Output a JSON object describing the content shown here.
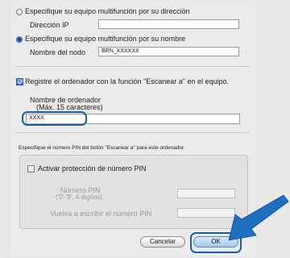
{
  "ip_option": {
    "label": "Especifique su equipo multifunción por su dirección",
    "selected": false,
    "field_label": "Dirección IP",
    "field_value": ""
  },
  "name_option": {
    "label": "Especifique su equipo multifunción por su nombre",
    "selected": true,
    "field_label": "Nombre del nodo",
    "field_value": "BRN_XXXXXX"
  },
  "register": {
    "label": "Registre el ordenador con la función \"Escanear a\" en el equipo.",
    "checked": true,
    "computer_name_label": "Nombre de ordenador",
    "computer_name_hint": "(Máx. 15 caracteres)",
    "computer_name_value": "XXXX"
  },
  "pin": {
    "description": "Especifique el número PIN del botón \"Escanear a\" para este ordenador.",
    "protect_label": "Activar protección de número PIN",
    "protect_checked": false,
    "pin_label": "Número PIN",
    "pin_hint": "('0'-'9', 4 dígitos)",
    "pin_value": "",
    "repeat_label": "Vuelva a escribir el número PIN",
    "repeat_value": ""
  },
  "buttons": {
    "cancel": "Cancelar",
    "ok": "OK"
  },
  "colors": {
    "highlight": "#1a5ea8",
    "arrow": "#1e6fc0"
  }
}
